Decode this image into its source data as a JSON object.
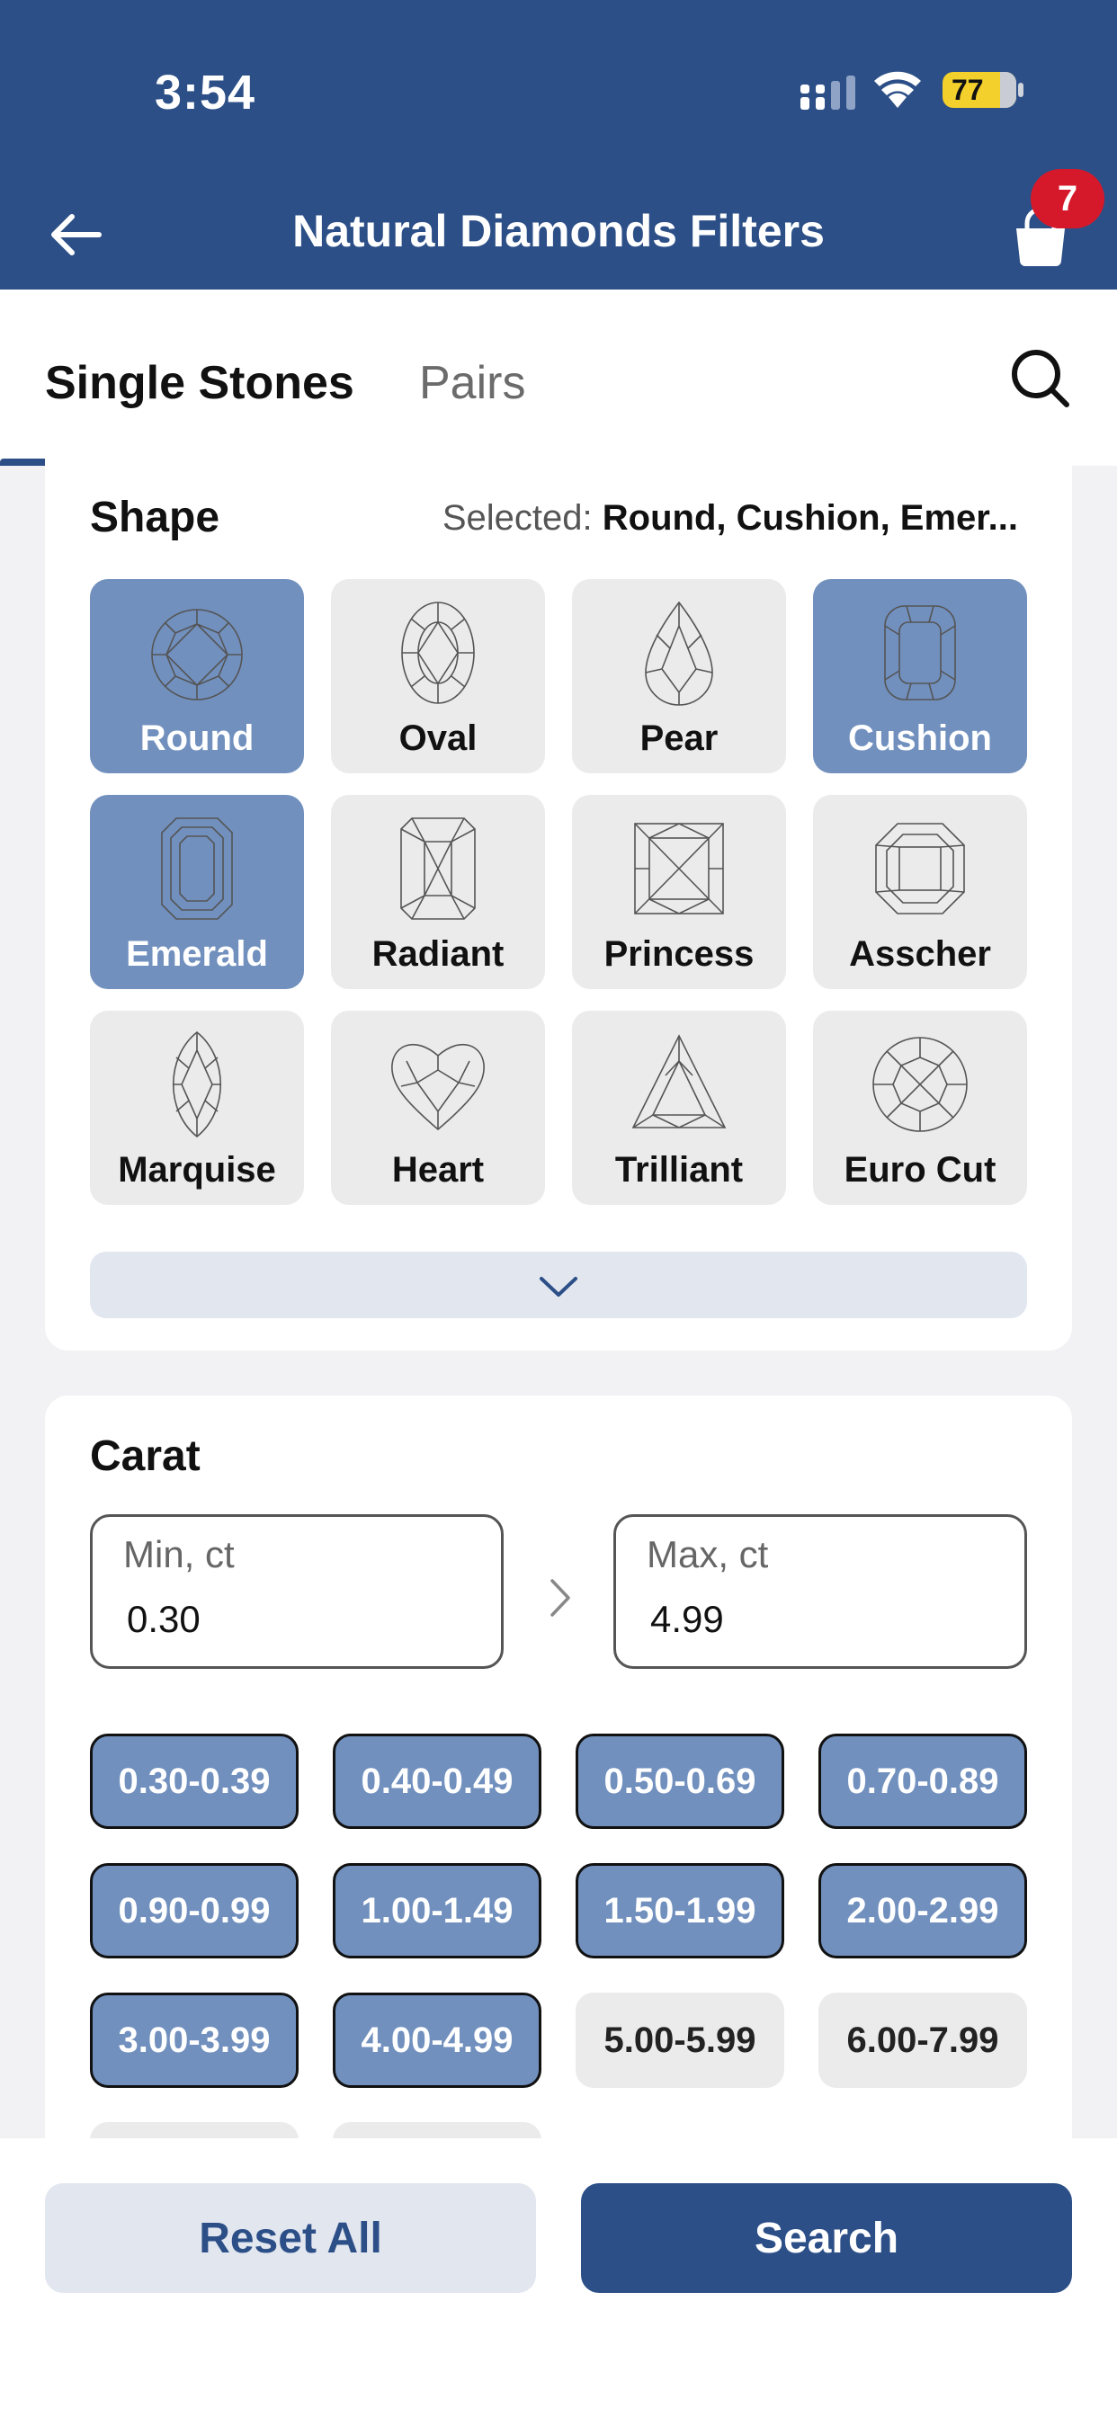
{
  "status": {
    "time": "3:54",
    "battery": "77"
  },
  "header": {
    "title": "Natural Diamonds Filters",
    "cart_count": "7"
  },
  "tabs": {
    "single": "Single Stones",
    "pairs": "Pairs"
  },
  "shape": {
    "title": "Shape",
    "selected_prefix": "Selected:",
    "selected_values": "Round, Cushion, Emer...",
    "items": [
      {
        "label": "Round",
        "selected": true,
        "icon": "round-diamond-icon"
      },
      {
        "label": "Oval",
        "selected": false,
        "icon": "oval-diamond-icon"
      },
      {
        "label": "Pear",
        "selected": false,
        "icon": "pear-diamond-icon"
      },
      {
        "label": "Cushion",
        "selected": true,
        "icon": "cushion-diamond-icon"
      },
      {
        "label": "Emerald",
        "selected": true,
        "icon": "emerald-diamond-icon"
      },
      {
        "label": "Radiant",
        "selected": false,
        "icon": "radiant-diamond-icon"
      },
      {
        "label": "Princess",
        "selected": false,
        "icon": "princess-diamond-icon"
      },
      {
        "label": "Asscher",
        "selected": false,
        "icon": "asscher-diamond-icon"
      },
      {
        "label": "Marquise",
        "selected": false,
        "icon": "marquise-diamond-icon"
      },
      {
        "label": "Heart",
        "selected": false,
        "icon": "heart-diamond-icon"
      },
      {
        "label": "Trilliant",
        "selected": false,
        "icon": "trilliant-diamond-icon"
      },
      {
        "label": "Euro Cut",
        "selected": false,
        "icon": "euro-cut-diamond-icon"
      }
    ]
  },
  "carat": {
    "title": "Carat",
    "min_placeholder": "Min, ct",
    "min_value": "0.30",
    "max_placeholder": "Max, ct",
    "max_value": "4.99",
    "ranges": [
      {
        "label": "0.30-0.39",
        "selected": true
      },
      {
        "label": "0.40-0.49",
        "selected": true
      },
      {
        "label": "0.50-0.69",
        "selected": true
      },
      {
        "label": "0.70-0.89",
        "selected": true
      },
      {
        "label": "0.90-0.99",
        "selected": true
      },
      {
        "label": "1.00-1.49",
        "selected": true
      },
      {
        "label": "1.50-1.99",
        "selected": true
      },
      {
        "label": "2.00-2.99",
        "selected": true
      },
      {
        "label": "3.00-3.99",
        "selected": true
      },
      {
        "label": "4.00-4.99",
        "selected": true
      },
      {
        "label": "5.00-5.99",
        "selected": false
      },
      {
        "label": "6.00-7.99",
        "selected": false
      }
    ]
  },
  "footer": {
    "reset": "Reset All",
    "search": "Search"
  },
  "colors": {
    "brand": "#2c4f87",
    "selected": "#7190be",
    "badge": "#d6192a"
  }
}
